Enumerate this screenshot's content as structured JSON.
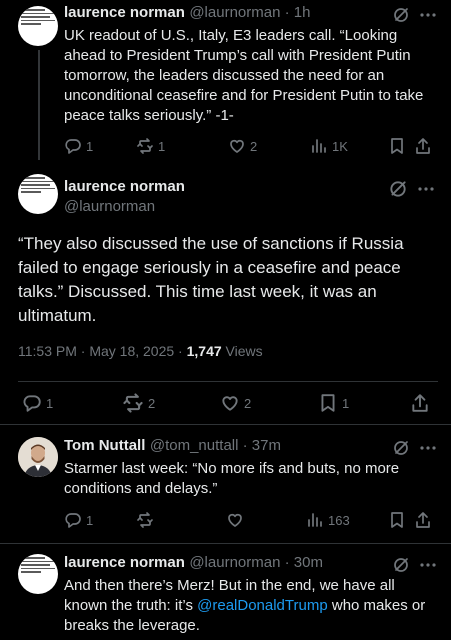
{
  "posts": [
    {
      "author": "laurence norman",
      "handle": "@laurnorman",
      "time": "1h",
      "text": "UK readout of U.S., Italy, E3 leaders call. “Looking ahead to President Trump’s call with President Putin tomorrow, the leaders discussed the need for an unconditional ceasefire and for President Putin to take peace talks seriously.” -1-",
      "replies": "1",
      "reposts": "1",
      "likes": "2",
      "views": "1K"
    },
    {
      "author": "laurence norman",
      "handle": "@laurnorman",
      "text": "“They also discussed the use of sanctions if Russia failed to engage seriously in a ceasefire and peace talks.”  Discussed. This time last week, it was an ultimatum.",
      "timestamp": "11:53 PM · May 18, 2025 · ",
      "views_count": "1,747",
      "views_label": " Views",
      "replies": "1",
      "reposts": "2",
      "likes": "2",
      "bookmarks": "1"
    },
    {
      "author": "Tom Nuttall",
      "handle": "@tom_nuttall",
      "time": "37m",
      "text": "Starmer last week: “No more ifs and buts, no more conditions and delays.”",
      "replies": "1",
      "views": "163"
    },
    {
      "author": "laurence norman",
      "handle": "@laurnorman",
      "time": "30m",
      "text_before": "And then there’s Merz! But in the end, we have all known the truth: it’s ",
      "mention": "@realDonaldTrump",
      "text_after": " who makes or breaks the leverage."
    }
  ],
  "separator": " · ",
  "icons": {
    "reply": "reply-icon",
    "repost": "repost-icon",
    "like": "heart-icon",
    "views": "views-icon",
    "bookmark": "bookmark-icon",
    "share": "share-icon",
    "grok": "grok-icon",
    "more": "more-icon"
  },
  "colors": {
    "background": "#000000",
    "text": "#e7e9ea",
    "secondary": "#71767b",
    "link": "#1d9bf0"
  }
}
